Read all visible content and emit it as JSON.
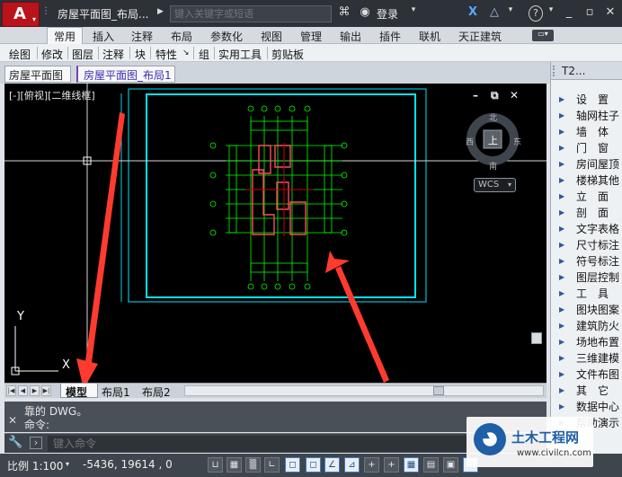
{
  "app": {
    "logo_letter": "A",
    "logo_sub": "CAD",
    "document_title": "房屋平面图_布局...",
    "search_placeholder": "键入关键字或短语",
    "login_label": "登录"
  },
  "ribbon": {
    "tabs": [
      "常用",
      "插入",
      "注释",
      "布局",
      "参数化",
      "视图",
      "管理",
      "输出",
      "插件",
      "联机",
      "天正建筑"
    ],
    "active_tab": "常用",
    "panels": [
      "绘图",
      "修改",
      "图层",
      "注释",
      "块",
      "特性",
      "组",
      "实用工具",
      "剪贴板"
    ]
  },
  "file_tabs": [
    "房屋平面图",
    "房屋平面图_布局1"
  ],
  "viewport": {
    "view_label": "[-][俯视][二维线框]",
    "compass": {
      "north": "北",
      "south": "南",
      "east": "东",
      "west": "西",
      "top": "上"
    },
    "wcs": "WCS",
    "axis_y": "Y",
    "axis_x": "X"
  },
  "layout_tabs": [
    "模型",
    "布局1",
    "布局2"
  ],
  "command": {
    "history_line": "靠的  DWG。",
    "prompt_line": "命令:",
    "input_placeholder": "键入命令"
  },
  "status": {
    "scale": "比例 1:100",
    "coordinates": "-5436,  19614 , 0"
  },
  "palette": {
    "title": "T2...",
    "items": [
      "设　置",
      "轴网柱子",
      "墙　体",
      "门　窗",
      "房间屋顶",
      "楼梯其他",
      "立　面",
      "剖　面",
      "文字表格",
      "尺寸标注",
      "符号标注",
      "图层控制",
      "工　具",
      "图块图案",
      "建筑防火",
      "场地布置",
      "三维建模",
      "文件布图",
      "其　它",
      "数据中心",
      "帮助演示"
    ]
  },
  "watermark": {
    "title": "土木工程网",
    "url": "www.civilcn.com"
  },
  "colors": {
    "canvas_bg": "#000000",
    "layout_frame": "#00e5ff",
    "axis_lines": "#00ff00",
    "walls": "#ff4b5c",
    "arrow": "#ff3b30"
  }
}
